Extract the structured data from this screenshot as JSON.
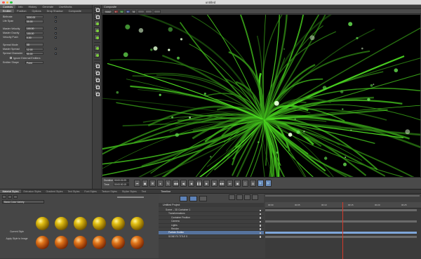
{
  "window": {
    "title": "untitled"
  },
  "left_panel": {
    "tabs": [
      "Controls",
      "Info",
      "History",
      "Generate",
      "UserMarks"
    ],
    "sub_tabs": [
      "Emitter",
      "Position",
      "Options",
      "Drop Shadow",
      "Composite"
    ],
    "params": [
      {
        "label": "Birthrate",
        "value": "3000.00"
      },
      {
        "label": "Life Span",
        "value": "30.00"
      },
      {
        "label": "Master Velocity",
        "value": "100.00"
      },
      {
        "label": "Master Gravity",
        "value": "100.00"
      },
      {
        "label": "Velocity Push",
        "value": "0.00"
      }
    ],
    "spread_mode": {
      "label": "Spread Mode",
      "value": "3D"
    },
    "master_spread": {
      "label": "Master Spread",
      "value": "12.00"
    },
    "spread_character": {
      "label": "Spread Character",
      "value": "50.00"
    },
    "ignore_emitters": {
      "label": "Ignore External Emitters"
    },
    "emitter_shape": {
      "label": "Emitter Shape",
      "value": "Point"
    }
  },
  "composite": {
    "title": "Composite",
    "toolbar": [
      "Color",
      "F",
      "G",
      "B",
      "A"
    ],
    "duration_label": "Duration",
    "duration_value": "00:00:01:09",
    "time_label": "Time",
    "time_value": "00:00:00:15"
  },
  "styles": {
    "tabs": [
      "Material Styles",
      "Extrusion Styles",
      "Gradient Styles",
      "Text Styles",
      "Font Styles",
      "Texture Styles",
      "Stylize Styles",
      "Text"
    ],
    "library": "Basic Color Variety",
    "current_style_label": "Current Style",
    "apply_style_label": "Apply Style to Image"
  },
  "timeline": {
    "title": "Timeline",
    "project": "Untitled Project",
    "rows": [
      {
        "label": "Scene – 3D Container 1"
      },
      {
        "label": "Transformations"
      },
      {
        "label": "Container Position"
      },
      {
        "label": "Camera"
      },
      {
        "label": "Lights"
      },
      {
        "label": "Render"
      },
      {
        "label": "Particle Emitter"
      },
      {
        "label": "SCNE FX TITLE S"
      }
    ],
    "ruler": [
      "00:00",
      "00:05",
      "00:10",
      "00:15",
      "00:20",
      "00:25"
    ]
  }
}
